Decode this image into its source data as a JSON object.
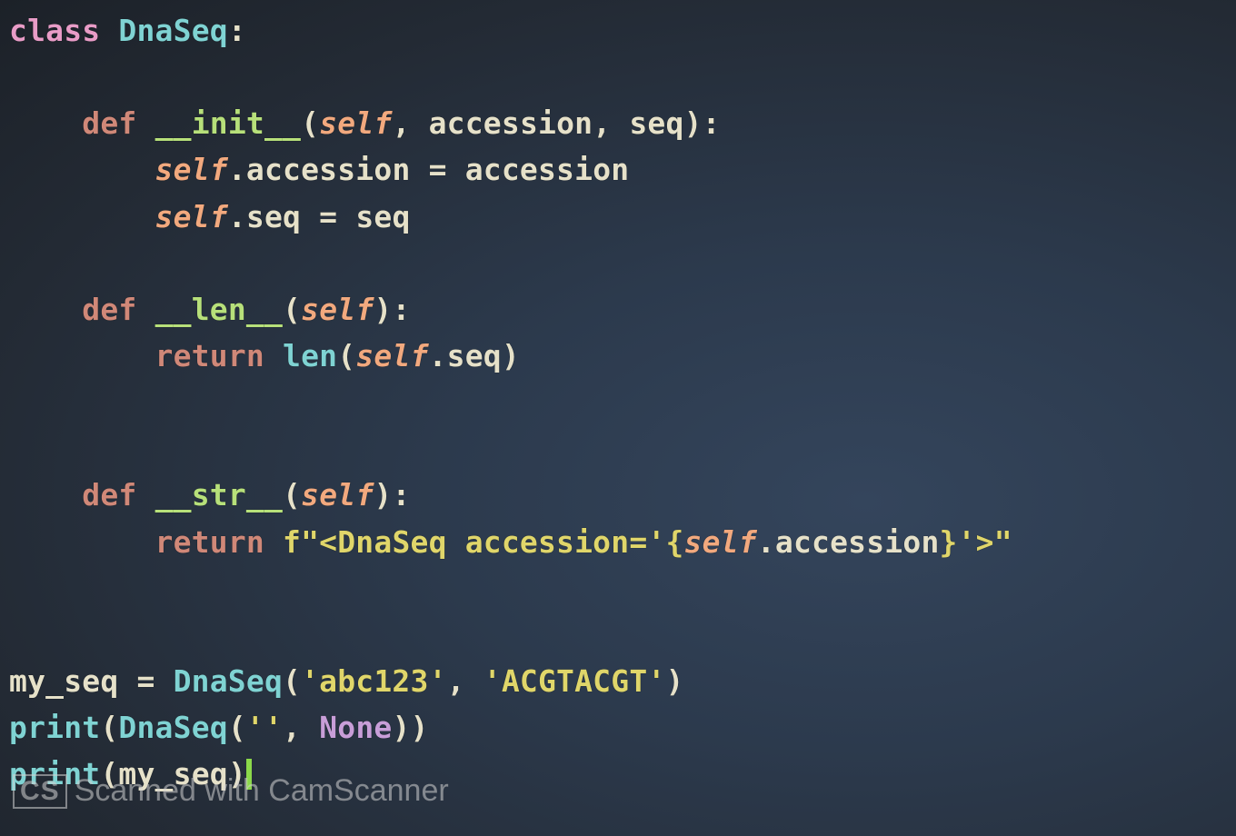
{
  "code": {
    "l1": {
      "kw": "class",
      "name": "DnaSeq",
      "colon": ":"
    },
    "blank1": "",
    "l2": {
      "kw": "def",
      "name": "__init__",
      "open": "(",
      "self": "self",
      "comma1": ", ",
      "p1": "accession",
      "comma2": ", ",
      "p2": "seq",
      "close": "):"
    },
    "l3": {
      "self": "self",
      "dot": ".",
      "attr": "accession",
      "eq": " = ",
      "rhs": "accession"
    },
    "l4": {
      "self": "self",
      "dot": ".",
      "attr": "seq",
      "eq": " = ",
      "rhs": "seq"
    },
    "blank2": "",
    "l5": {
      "kw": "def",
      "name": "__len__",
      "open": "(",
      "self": "self",
      "close": "):"
    },
    "l6": {
      "kw": "return",
      "sp": " ",
      "fn": "len",
      "open": "(",
      "self": "self",
      "dot": ".",
      "attr": "seq",
      "close": ")"
    },
    "blank3": "",
    "blank4": "",
    "l7": {
      "kw": "def",
      "name": "__str__",
      "open": "(",
      "self": "self",
      "close": "):"
    },
    "l8": {
      "kw": "return",
      "sp": " ",
      "fpre": "f\"",
      "s1": "<DnaSeq accession='",
      "ob": "{",
      "self": "self",
      "dot": ".",
      "attr": "accession",
      "cb": "}",
      "s2": "'>",
      "q": "\""
    },
    "blank5": "",
    "blank6": "",
    "l9": {
      "lhs": "my_seq",
      "eq": " = ",
      "cls": "DnaSeq",
      "open": "(",
      "s1": "'abc123'",
      "comma": ", ",
      "s2": "'ACGTACGT'",
      "close": ")"
    },
    "l10": {
      "fn": "print",
      "open": "(",
      "cls": "DnaSeq",
      "open2": "(",
      "s1": "''",
      "comma": ", ",
      "none": "None",
      "close2": ")",
      "close": ")"
    },
    "l11": {
      "fn": "print",
      "open": "(",
      "arg": "my_seq",
      "close": ")"
    }
  },
  "watermark": {
    "badge": "CS",
    "text": "Scanned with CamScanner"
  }
}
